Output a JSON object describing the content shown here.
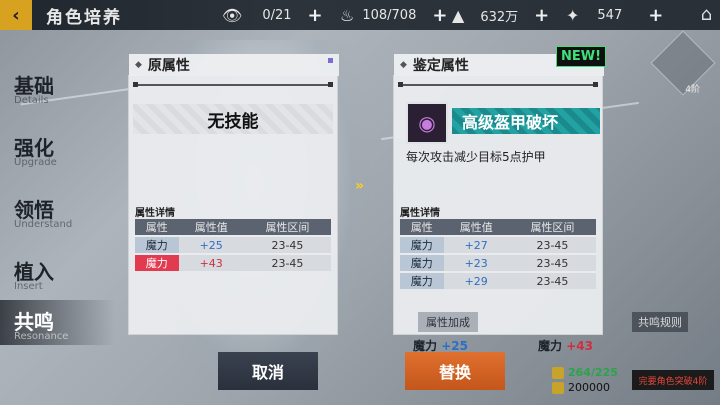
{
  "topbar": {
    "title": "角色培养",
    "resources": [
      {
        "icon": "eye-icon",
        "value": "0/21"
      },
      {
        "icon": "flame-icon",
        "value": "108/708"
      },
      {
        "icon": "triangle-icon",
        "value": "632万"
      },
      {
        "icon": "star-icon",
        "value": "547"
      }
    ]
  },
  "menu": [
    {
      "cn": "基础",
      "en": "Details"
    },
    {
      "cn": "强化",
      "en": "Upgrade"
    },
    {
      "cn": "领悟",
      "en": "Understand"
    },
    {
      "cn": "植入",
      "en": "Insert"
    },
    {
      "cn": "共鸣",
      "en": "Resonance"
    }
  ],
  "left_panel": {
    "header": "原属性",
    "skill": "无技能",
    "section_title": "属性详情",
    "columns": [
      "属性",
      "属性值",
      "属性区间"
    ],
    "rows": [
      {
        "attr": "魔力",
        "value": "+25",
        "range": "23-45"
      },
      {
        "attr": "魔力",
        "value": "+43",
        "range": "23-45"
      }
    ]
  },
  "right_panel": {
    "header": "鉴定属性",
    "new_tag": "NEW!",
    "skill": "高级盔甲破坏",
    "description": "每次攻击减少目标5点护甲",
    "section_title": "属性详情",
    "columns": [
      "属性",
      "属性值",
      "属性区间"
    ],
    "rows": [
      {
        "attr": "魔力",
        "value": "+27",
        "range": "23-45"
      },
      {
        "attr": "魔力",
        "value": "+23",
        "range": "23-45"
      },
      {
        "attr": "魔力",
        "value": "+29",
        "range": "23-45"
      }
    ]
  },
  "transfer_arrow": "»",
  "bonus": {
    "label": "属性加成",
    "v1_name": "魔力",
    "v1": "+25",
    "v2_name": "魔力",
    "v2": "+43"
  },
  "rules_button": "共鸣规则",
  "buttons": {
    "cancel": "取消",
    "confirm": "替换"
  },
  "cost": {
    "item1": "264/225",
    "item2": "200000"
  },
  "warning": "完要角色突破4阶",
  "corner_badge": "4阶"
}
